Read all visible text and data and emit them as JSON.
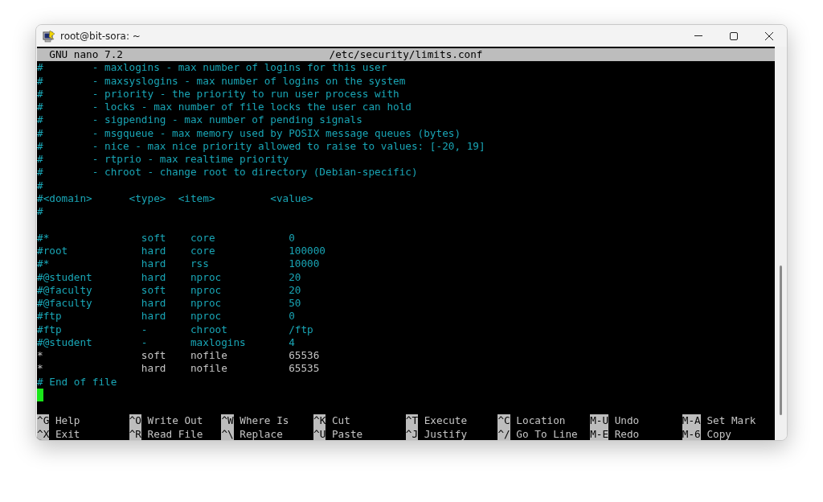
{
  "window": {
    "title": "root@bit-sora: ~"
  },
  "nano_header": {
    "version": "GNU nano 7.2",
    "filename": "/etc/security/limits.conf"
  },
  "lines": [
    {
      "kind": "comment",
      "text": "#        - maxlogins - max number of logins for this user"
    },
    {
      "kind": "comment",
      "text": "#        - maxsyslogins - max number of logins on the system"
    },
    {
      "kind": "comment",
      "text": "#        - priority - the priority to run user process with"
    },
    {
      "kind": "comment",
      "text": "#        - locks - max number of file locks the user can hold"
    },
    {
      "kind": "comment",
      "text": "#        - sigpending - max number of pending signals"
    },
    {
      "kind": "comment",
      "text": "#        - msgqueue - max memory used by POSIX message queues (bytes)"
    },
    {
      "kind": "comment",
      "text": "#        - nice - max nice priority allowed to raise to values: [-20, 19]"
    },
    {
      "kind": "comment",
      "text": "#        - rtprio - max realtime priority"
    },
    {
      "kind": "comment",
      "text": "#        - chroot - change root to directory (Debian-specific)"
    },
    {
      "kind": "comment",
      "text": "#"
    },
    {
      "kind": "comment",
      "text": "#<domain>      <type>  <item>         <value>"
    },
    {
      "kind": "comment",
      "text": "#"
    },
    {
      "kind": "blank"
    },
    {
      "kind": "comment",
      "text": "#*               soft    core            0"
    },
    {
      "kind": "comment",
      "text": "#root            hard    core            100000"
    },
    {
      "kind": "comment",
      "text": "#*               hard    rss             10000"
    },
    {
      "kind": "comment",
      "text": "#@student        hard    nproc           20"
    },
    {
      "kind": "comment",
      "text": "#@faculty        soft    nproc           20"
    },
    {
      "kind": "comment",
      "text": "#@faculty        hard    nproc           50"
    },
    {
      "kind": "comment",
      "text": "#ftp             hard    nproc           0"
    },
    {
      "kind": "comment",
      "text": "#ftp             -       chroot          /ftp"
    },
    {
      "kind": "comment",
      "text": "#@student        -       maxlogins       4"
    },
    {
      "kind": "plain",
      "text": "*                soft    nofile          65536"
    },
    {
      "kind": "plain",
      "text": "*                hard    nofile          65535"
    },
    {
      "kind": "comment",
      "text": "# End of file"
    },
    {
      "kind": "cursor"
    },
    {
      "kind": "blank"
    }
  ],
  "shortcuts": [
    [
      {
        "key": "^G",
        "label": "Help"
      },
      {
        "key": "^O",
        "label": "Write Out"
      },
      {
        "key": "^W",
        "label": "Where Is"
      },
      {
        "key": "^K",
        "label": "Cut"
      },
      {
        "key": "^T",
        "label": "Execute"
      },
      {
        "key": "^C",
        "label": "Location"
      },
      {
        "key": "M-U",
        "label": "Undo"
      },
      {
        "key": "M-A",
        "label": "Set Mark"
      }
    ],
    [
      {
        "key": "^X",
        "label": "Exit"
      },
      {
        "key": "^R",
        "label": "Read File"
      },
      {
        "key": "^\\",
        "label": "Replace"
      },
      {
        "key": "^U",
        "label": "Paste"
      },
      {
        "key": "^J",
        "label": "Justify"
      },
      {
        "key": "^/",
        "label": "Go To Line"
      },
      {
        "key": "M-E",
        "label": "Redo"
      },
      {
        "key": "M-6",
        "label": "Copy"
      }
    ]
  ]
}
